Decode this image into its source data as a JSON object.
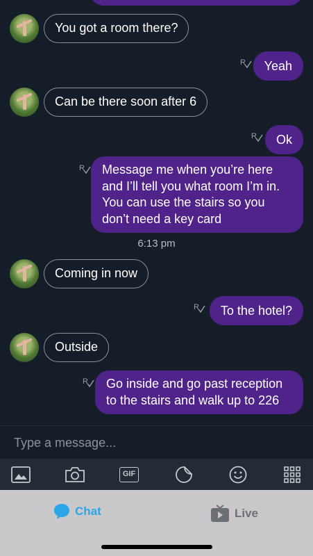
{
  "messages": {
    "m1": "You got a room there?",
    "m2": "Yeah",
    "m3": "Can be there soon after 6",
    "m4": "Ok",
    "m5_lines": [
      "Message me when you’re here",
      "and I’ll tell you what room I’m in.",
      "You can use the stairs so you",
      "don’t need a key card"
    ],
    "timestamp": "6:13 pm",
    "m6": "Coming in now",
    "m7": "To the hotel?",
    "m8": "Outside",
    "m9_lines": [
      "Go inside and go past reception",
      "to the stairs and walk up to 226"
    ]
  },
  "composer": {
    "placeholder": "Type a message..."
  },
  "toolbar": {
    "icons": [
      "image-icon",
      "camera-icon",
      "gif-icon",
      "sticker-icon",
      "emoji-icon",
      "grid-icon"
    ],
    "gif_label": "GIF"
  },
  "tabs": {
    "chat_label": "Chat",
    "live_label": "Live",
    "chat_color": "#2aa6e8",
    "live_color": "#6c6f75"
  },
  "colors": {
    "background": "#151d28",
    "outgoing_bubble": "#50238a",
    "incoming_border": "#8b9098"
  }
}
